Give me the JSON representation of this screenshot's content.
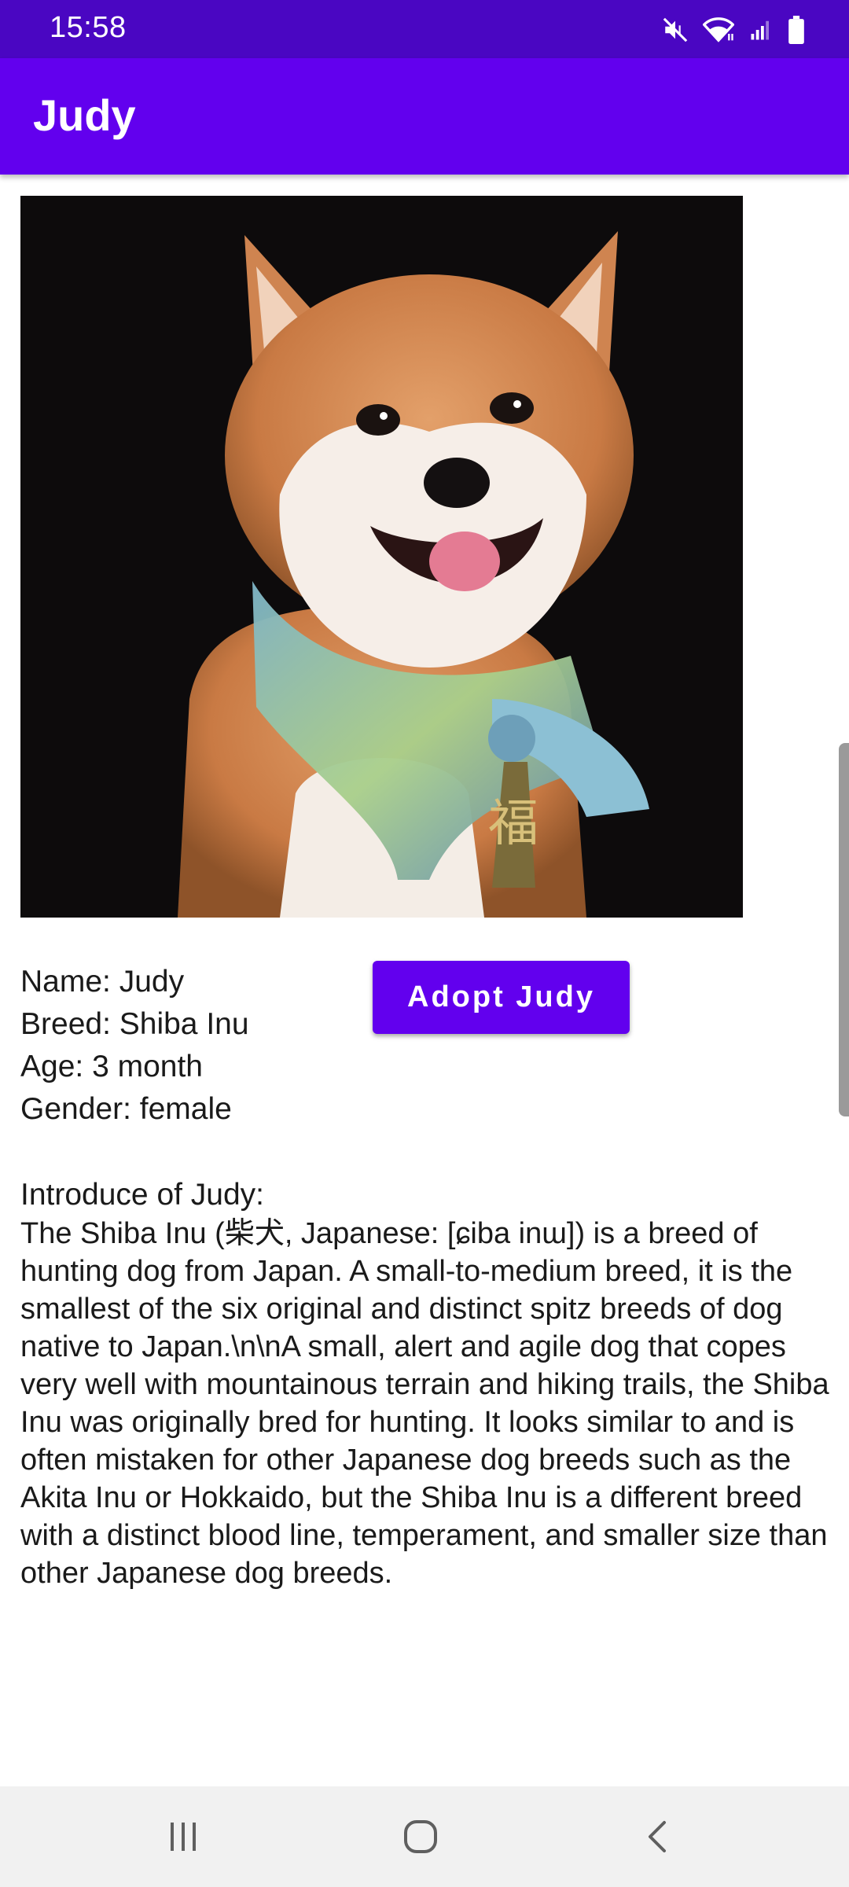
{
  "status_bar": {
    "time": "15:58",
    "icons": [
      "mute-icon",
      "wifi-icon",
      "signal-icon",
      "battery-icon"
    ]
  },
  "app_bar": {
    "title": "Judy"
  },
  "pet": {
    "photo_icon": "shiba-inu-photo",
    "name_line": "Name: Judy",
    "breed_line": "Breed: Shiba Inu",
    "age_line": "Age: 3 month",
    "gender_line": "Gender: female"
  },
  "adopt_button": {
    "label": "Adopt Judy"
  },
  "intro": {
    "heading": "Introduce of Judy:",
    "text": "The Shiba Inu (柴犬, Japanese: [ɕiba inɯ]) is a breed of hunting dog from Japan. A small-to-medium breed, it is the smallest of the six original and distinct spitz breeds of dog native to Japan.\\n\\nA small, alert and agile dog that copes very well with mountainous terrain and hiking trails, the Shiba Inu was originally bred for hunting. It looks similar to and is often mistaken for other Japanese dog breeds such as the Akita Inu or Hokkaido, but the Shiba Inu is a different breed with a distinct blood line, temperament, and smaller size than other Japanese dog breeds."
  },
  "nav_bar": {
    "buttons": [
      "recents-icon",
      "home-icon",
      "back-icon"
    ]
  },
  "colors": {
    "status_bar": "#4a06c2",
    "primary": "#6200ee",
    "nav_bar": "#f1f1f1"
  }
}
